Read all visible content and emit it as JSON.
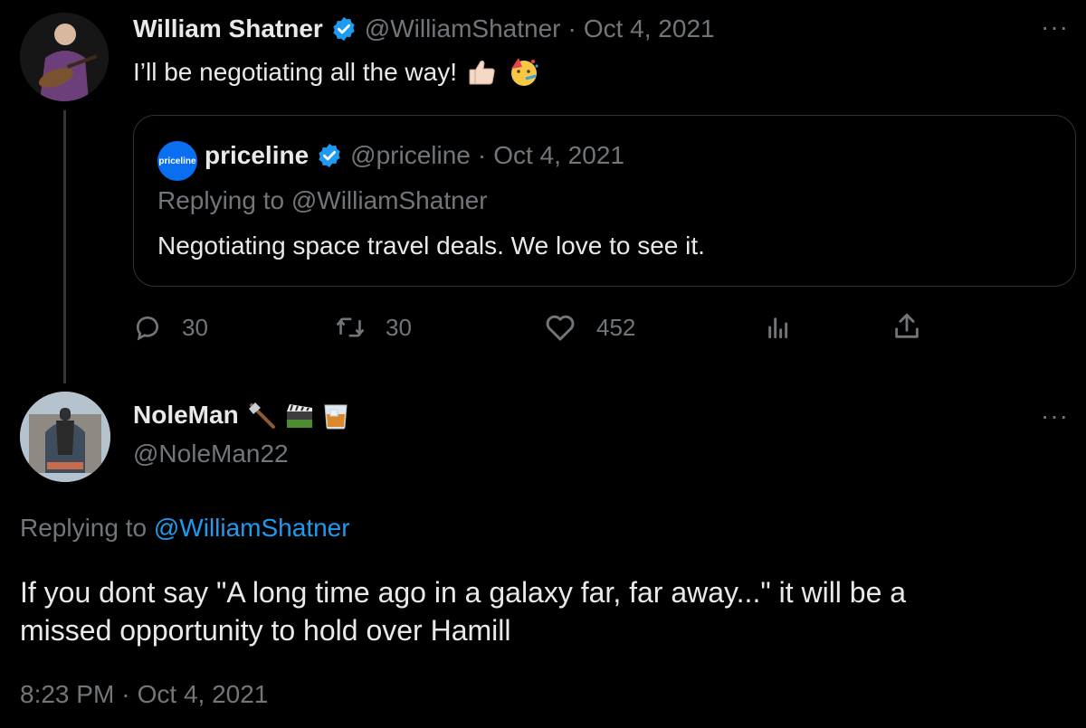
{
  "tweet1": {
    "author_name": "William Shatner",
    "handle": "@WilliamShatner",
    "separator": "·",
    "date": "Oct 4, 2021",
    "text": "I’ll be negotiating all the way!",
    "emojis": [
      "thumbs-up-icon",
      "party-face-icon"
    ],
    "quote": {
      "author_name": "priceline",
      "avatar_text": "priceline",
      "handle": "@priceline",
      "separator": "·",
      "date": "Oct 4, 2021",
      "replying_to": "Replying to @WilliamShatner",
      "text": "Negotiating space travel deals. We love to see it."
    },
    "actions": {
      "replies": "30",
      "retweets": "30",
      "likes": "452"
    },
    "more": "···"
  },
  "tweet2": {
    "author_name": "NoleMan",
    "name_emojis": [
      "axe-icon",
      "clapper-icon",
      "whiskey-glass-icon"
    ],
    "handle": "@NoleMan22",
    "replying_prefix": "Replying to",
    "replying_handle": "@WilliamShatner",
    "text_line1": "If you dont say \"A long time ago in a galaxy far, far away...\" it will be a",
    "text_line2": "missed opportunity to hold over Hamill",
    "timestamp": "8:23 PM",
    "separator": "·",
    "date": "Oct 4, 2021",
    "more": "···"
  },
  "colors": {
    "background": "#000000",
    "text": "#e7e9ea",
    "muted": "#71767b",
    "link": "#1d9bf0",
    "verified": "#1d9bf0",
    "border": "#2f3336"
  }
}
